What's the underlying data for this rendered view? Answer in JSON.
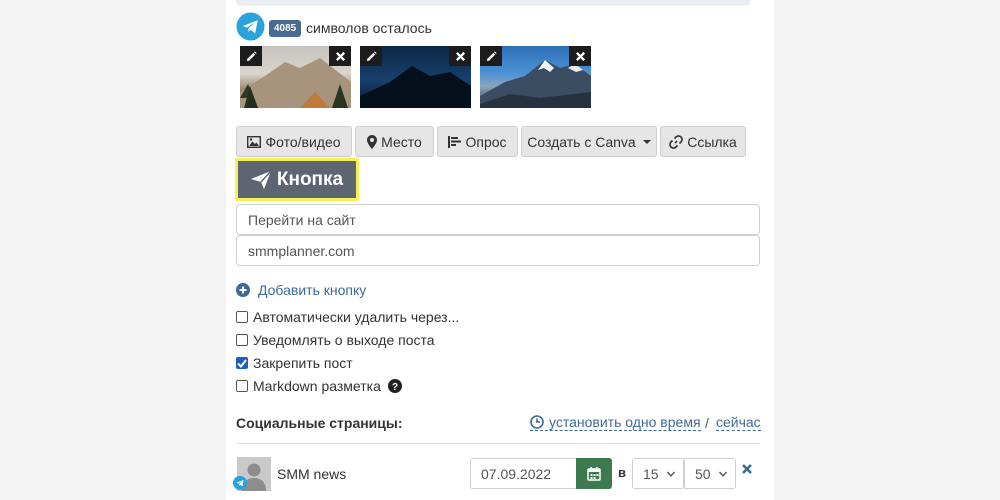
{
  "header": {
    "chars_left_count": "4085",
    "chars_left_text": "символов осталось"
  },
  "media": {
    "thumbnails": [
      "mountain-fog",
      "mountain-night",
      "mountain-snow"
    ]
  },
  "toolbar": {
    "photo_label": "Фото/видео",
    "place_label": "Место",
    "poll_label": "Опрос",
    "canva_label": "Создать с Canva",
    "link_label": "Ссылка"
  },
  "button_block": {
    "button_label": "Кнопка",
    "button_text_value": "Перейти на сайт",
    "button_url_value": "smmplanner.com",
    "add_button_label": "Добавить кнопку"
  },
  "options": {
    "auto_delete": {
      "label": "Автоматически удалить через...",
      "checked": false
    },
    "notify": {
      "label": "Уведомлять о выходе поста",
      "checked": false
    },
    "pin": {
      "label": "Закрепить пост",
      "checked": true
    },
    "markdown": {
      "label": "Markdown разметка",
      "checked": false
    }
  },
  "social": {
    "title": "Социальные страницы:",
    "set_one_time": "установить одно время",
    "separator": "/",
    "now": "сейчас",
    "page": {
      "name": "SMM news",
      "date": "07.09.2022",
      "at": "в",
      "hour": "15",
      "minute": "50"
    }
  },
  "colors": {
    "telegram": "#2aa3dc",
    "badge": "#4a6b91",
    "link": "#3d6a98",
    "highlight_border": "#f3f05a",
    "highlight_bg": "#5d6670",
    "calendar_button": "#3d7a4f",
    "checkbox_checked": "#1d5fbf"
  }
}
